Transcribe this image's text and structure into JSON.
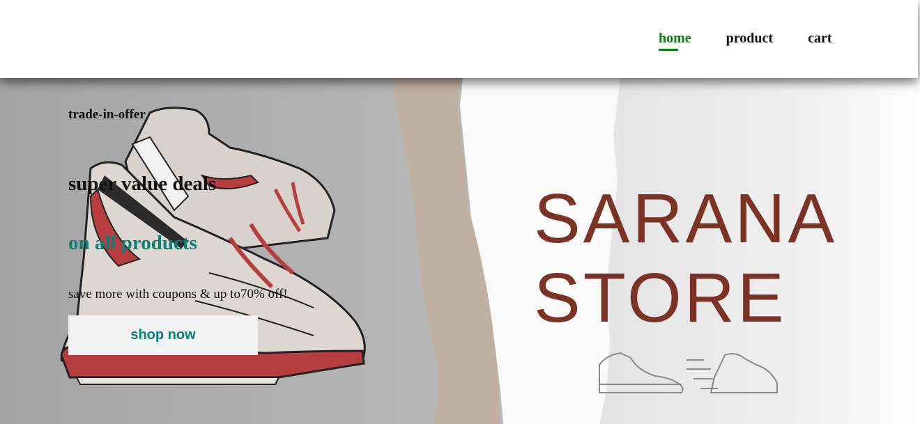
{
  "nav": {
    "items": [
      {
        "label": "home",
        "active": true
      },
      {
        "label": "product",
        "active": false
      },
      {
        "label": "cart",
        "active": false
      }
    ],
    "active_color": "#0c7a0c"
  },
  "hero": {
    "offer_label": "trade-in-offer",
    "headline": "super value deals",
    "subheadline": "on all products",
    "tagline": "save more with coupons & up to70% off!",
    "button_label": "shop now",
    "accent_color": "#0a8078",
    "banner": {
      "brand_line1": "SARANA",
      "brand_line2": "STORE",
      "brand_color": "#7a3324"
    }
  }
}
